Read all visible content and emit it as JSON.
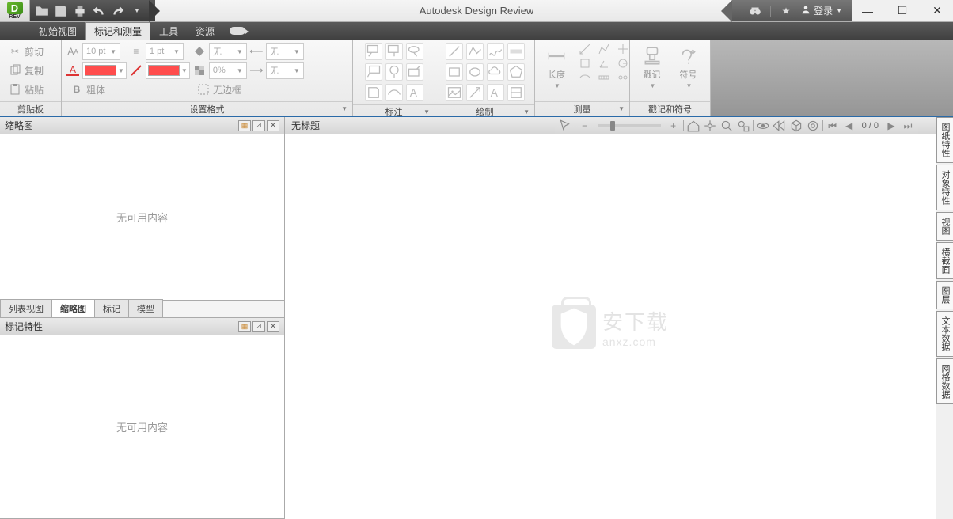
{
  "app": {
    "title": "Autodesk Design Review",
    "logo_letter": "D",
    "logo_sub": "REV"
  },
  "login": {
    "label": "登录"
  },
  "menus": {
    "initial_view": "初始视图",
    "markup_measure": "标记和测量",
    "tools": "工具",
    "resources": "资源"
  },
  "clipboard": {
    "title": "剪贴板",
    "cut": "剪切",
    "copy": "复制",
    "paste": "粘贴"
  },
  "format": {
    "title": "设置格式",
    "font_size": "10 pt",
    "line_weight": "1 pt",
    "fill_none": "无",
    "line_none": "无",
    "opacity": "0%",
    "arrow_none": "无",
    "bold": "粗体",
    "no_border": "无边框",
    "swatch_color": "#ff4d4d"
  },
  "callout_panel": {
    "title": "标注"
  },
  "draw_panel": {
    "title": "绘制"
  },
  "measure_panel": {
    "title": "测量",
    "length": "长度"
  },
  "stamp_panel": {
    "title": "戳记和符号",
    "stamp": "戳记",
    "symbol": "符号"
  },
  "left_pane": {
    "thumbnails_title": "缩略图",
    "markup_props_title": "标记特性",
    "no_content": "无可用内容",
    "tabs": {
      "list_view": "列表视图",
      "thumbnails": "缩略图",
      "markup": "标记",
      "model": "模型"
    }
  },
  "canvas": {
    "untitled": "无标题",
    "page_info": "0 / 0",
    "watermark_ch": "安下载",
    "watermark_en": "anxz.com"
  },
  "right_tabs": {
    "tab1": "图纸特性",
    "tab2": "对象特性",
    "tab3": "视图",
    "tab4": "横截面",
    "tab5": "图层",
    "tab6": "文本数据",
    "tab7": "网格数据"
  }
}
